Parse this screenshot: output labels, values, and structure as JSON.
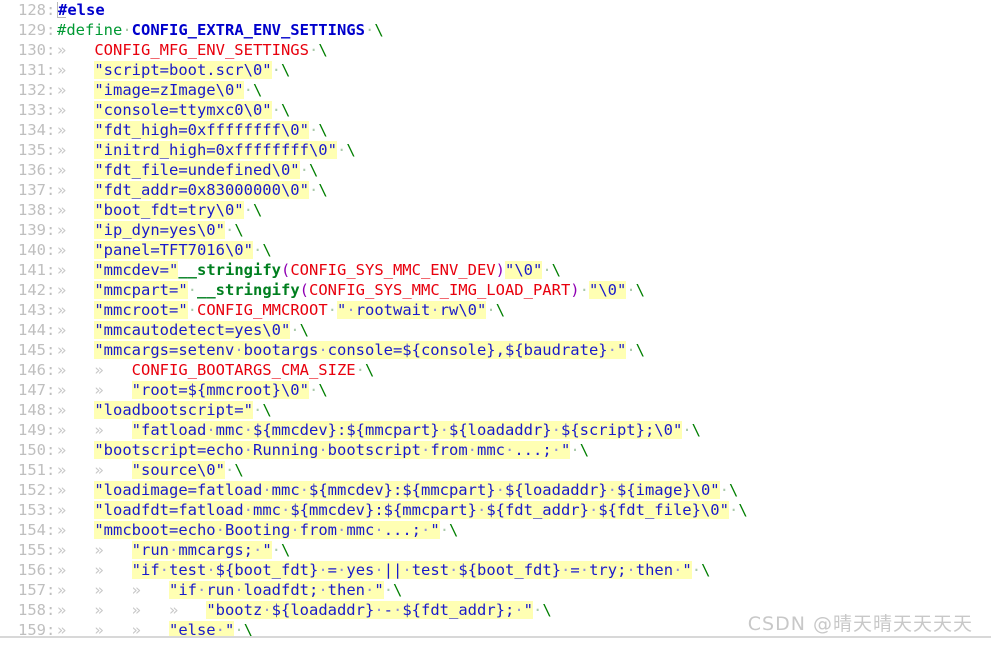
{
  "editor": {
    "first_line": 128,
    "last_line": 159,
    "gutter_separator": ":",
    "tab_glyph": "»",
    "space_glyph": "·",
    "colors": {
      "background": "#ffffff",
      "line_number": "#bfbfbf",
      "string": "#1a1acc",
      "string_highlight": "#ffffb3",
      "preproc": "#009933",
      "macro": "#e8000d",
      "identifier_bold": "#0000cc",
      "function": "#007f1f",
      "paren": "#8f00b3",
      "backslash": "#007f00",
      "tab_marker": "#c9c9c9"
    },
    "lines": [
      {
        "num": "128",
        "text": "#else"
      },
      {
        "num": "129",
        "text": "#define CONFIG_EXTRA_ENV_SETTINGS \\"
      },
      {
        "num": "130",
        "text": "\tCONFIG_MFG_ENV_SETTINGS \\"
      },
      {
        "num": "131",
        "text": "\t\"script=boot.scr\\0\" \\"
      },
      {
        "num": "132",
        "text": "\t\"image=zImage\\0\" \\"
      },
      {
        "num": "133",
        "text": "\t\"console=ttymxc0\\0\" \\"
      },
      {
        "num": "134",
        "text": "\t\"fdt_high=0xffffffff\\0\" \\"
      },
      {
        "num": "135",
        "text": "\t\"initrd_high=0xffffffff\\0\" \\"
      },
      {
        "num": "136",
        "text": "\t\"fdt_file=undefined\\0\" \\"
      },
      {
        "num": "137",
        "text": "\t\"fdt_addr=0x83000000\\0\" \\"
      },
      {
        "num": "138",
        "text": "\t\"boot_fdt=try\\0\" \\"
      },
      {
        "num": "139",
        "text": "\t\"ip_dyn=yes\\0\" \\"
      },
      {
        "num": "140",
        "text": "\t\"panel=TFT7016\\0\" \\"
      },
      {
        "num": "141",
        "text": "\t\"mmcdev=\"__stringify(CONFIG_SYS_MMC_ENV_DEV)\"\\0\" \\"
      },
      {
        "num": "142",
        "text": "\t\"mmcpart=\" __stringify(CONFIG_SYS_MMC_IMG_LOAD_PART) \"\\0\" \\"
      },
      {
        "num": "143",
        "text": "\t\"mmcroot=\" CONFIG_MMCROOT \" rootwait rw\\0\" \\"
      },
      {
        "num": "144",
        "text": "\t\"mmcautodetect=yes\\0\" \\"
      },
      {
        "num": "145",
        "text": "\t\"mmcargs=setenv bootargs console=${console},${baudrate} \" \\"
      },
      {
        "num": "146",
        "text": "\t\tCONFIG_BOOTARGS_CMA_SIZE \\"
      },
      {
        "num": "147",
        "text": "\t\t\"root=${mmcroot}\\0\" \\"
      },
      {
        "num": "148",
        "text": "\t\"loadbootscript=\" \\"
      },
      {
        "num": "149",
        "text": "\t\t\"fatload mmc ${mmcdev}:${mmcpart} ${loadaddr} ${script};\\0\" \\"
      },
      {
        "num": "150",
        "text": "\t\"bootscript=echo Running bootscript from mmc ...; \" \\"
      },
      {
        "num": "151",
        "text": "\t\t\"source\\0\" \\"
      },
      {
        "num": "152",
        "text": "\t\"loadimage=fatload mmc ${mmcdev}:${mmcpart} ${loadaddr} ${image}\\0\" \\"
      },
      {
        "num": "153",
        "text": "\t\"loadfdt=fatload mmc ${mmcdev}:${mmcpart} ${fdt_addr} ${fdt_file}\\0\" \\"
      },
      {
        "num": "154",
        "text": "\t\"mmcboot=echo Booting from mmc ...; \" \\"
      },
      {
        "num": "155",
        "text": "\t\t\"run mmcargs; \" \\"
      },
      {
        "num": "156",
        "text": "\t\t\"if test ${boot_fdt} = yes || test ${boot_fdt} = try; then \" \\"
      },
      {
        "num": "157",
        "text": "\t\t\t\"if run loadfdt; then \" \\"
      },
      {
        "num": "158",
        "text": "\t\t\t\t\"bootz ${loadaddr} - ${fdt_addr}; \" \\"
      },
      {
        "num": "159",
        "text": "\t\t\t\"else \" \\"
      }
    ]
  },
  "watermark": {
    "text": "CSDN @晴天晴天天天天"
  }
}
